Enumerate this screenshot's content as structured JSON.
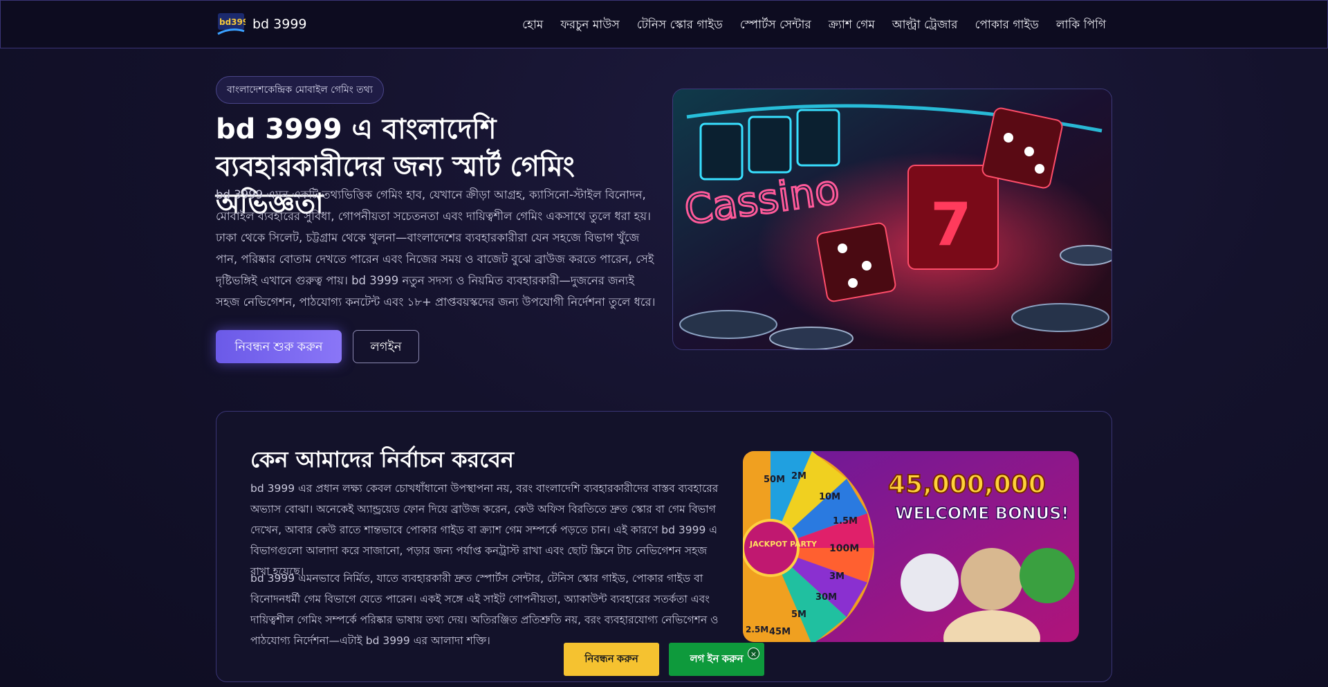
{
  "brand": {
    "name": "bd 3999",
    "logo_text": "bd3999"
  },
  "nav": {
    "items": [
      {
        "label": "হোম"
      },
      {
        "label": "ফরচুন মাউস"
      },
      {
        "label": "টেনিস স্কোর গাইড"
      },
      {
        "label": "স্পোর্টস সেন্টার"
      },
      {
        "label": "ক্র্যাশ গেম"
      },
      {
        "label": "আল্ট্রা ট্রেজার"
      },
      {
        "label": "পোকার গাইড"
      },
      {
        "label": "লাকি পিগি"
      }
    ]
  },
  "hero": {
    "badge": "বাংলাদেশকেন্দ্রিক মোবাইল গেমিং তথ্য",
    "title": "bd 3999 এ বাংলাদেশি ব্যবহারকারীদের জন্য স্মার্ট গেমিং অভিজ্ঞতা",
    "description": "bd 3999 এমন একটি তথ্যভিত্তিক গেমিং হাব, যেখানে ক্রীড়া আগ্রহ, ক্যাসিনো-স্টাইল বিনোদন, মোবাইল ব্যবহারের সুবিধা, গোপনীয়তা সচেতনতা এবং দায়িত্বশীল গেমিং একসাথে তুলে ধরা হয়। ঢাকা থেকে সিলেট, চট্টগ্রাম থেকে খুলনা—বাংলাদেশের ব্যবহারকারীরা যেন সহজে বিভাগ খুঁজে পান, পরিষ্কার বোতাম দেখতে পারেন এবং নিজের সময় ও বাজেট বুঝে ব্রাউজ করতে পারেন, সেই দৃষ্টিভঙ্গিই এখানে গুরুত্ব পায়। bd 3999 নতুন সদস্য ও নিয়মিত ব্যবহারকারী—দুজনের জন্যই সহজ নেভিগেশন, পাঠযোগ্য কনটেন্ট এবং ১৮+ প্রাপ্তবয়স্কদের জন্য উপযোগী নির্দেশনা তুলে ধরে।",
    "primary_button": "নিবন্ধন শুরু করুন",
    "secondary_button": "লগইন",
    "image_sign_text": "Cassino"
  },
  "why_section": {
    "title": "কেন আমাদের নির্বাচন করবেন",
    "paragraph_1": "bd 3999 এর প্রধান লক্ষ্য কেবল চোখধাঁধানো উপস্থাপনা নয়, বরং বাংলাদেশি ব্যবহারকারীদের বাস্তব ব্যবহারের অভ্যাস বোঝা। অনেকেই অ্যান্ড্রয়েড ফোন দিয়ে ব্রাউজ করেন, কেউ অফিস বিরতিতে দ্রুত স্কোর বা গেম বিভাগ দেখেন, আবার কেউ রাতে শান্তভাবে পোকার গাইড বা ক্র্যাশ গেম সম্পর্কে পড়তে চান। এই কারণে bd 3999 এ বিভাগগুলো আলাদা করে সাজানো, পড়ার জন্য পর্যাপ্ত কনট্রাস্ট রাখা এবং ছোট স্ক্রিনে টাচ নেভিগেশন সহজ রাখা হয়েছে।",
    "paragraph_2": "bd 3999 এমনভাবে নির্মিত, যাতে ব্যবহারকারী দ্রুত স্পোর্টস সেন্টার, টেনিস স্কোর গাইড, পোকার গাইড বা বিনোদনধর্মী গেম বিভাগে যেতে পারেন। একই সঙ্গে এই সাইট গোপনীয়তা, অ্যাকাউন্ট ব্যবহারের সতর্কতা এবং দায়িত্বশীল গেমিং সম্পর্কে পরিষ্কার ভাষায় তথ্য দেয়। অতিরঞ্জিত প্রতিশ্রুতি নয়, বরং ব্যবহারযোগ্য নেভিগেশন ও পাঠযোগ্য নির্দেশনা—এটাই bd 3999 এর আলাদা শক্তি।",
    "image": {
      "bonus_amount": "45,000,000",
      "bonus_label": "WELCOME BONUS!",
      "wheel_center": "JACKPOT PARTY",
      "wheel_values": [
        "50M",
        "2M",
        "10M",
        "1.5M",
        "100M",
        "3M",
        "30M",
        "5M",
        "45M",
        "2.5M"
      ]
    }
  },
  "sticky_cta": {
    "register": "নিবন্ধন করুন",
    "login": "লগ ইন করুন",
    "close": "×"
  },
  "colors": {
    "background": "#14122c",
    "accent": "#7b68f0",
    "register_yellow": "#f5c230",
    "login_green": "#0e9a3c"
  }
}
